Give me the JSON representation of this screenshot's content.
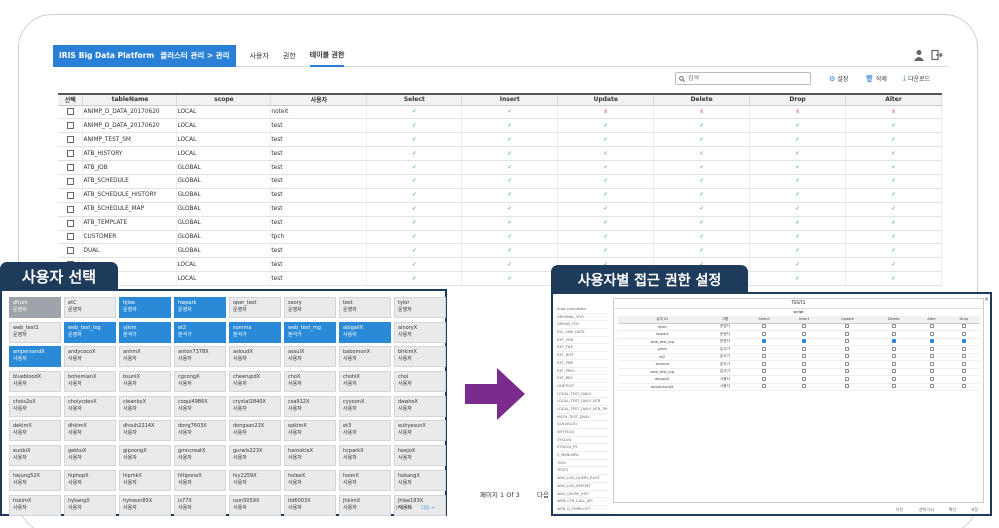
{
  "app": {
    "brand_logo": "IRIS",
    "brand_name": "Big Data Platform",
    "breadcrumb": "클러스터 관리 > 관리",
    "tabs": [
      "사용자",
      "권한",
      "테이블 권한"
    ],
    "active_tab": "테이블 권한",
    "search_placeholder": "검색",
    "btn_settings": "설정",
    "btn_delete": "삭제",
    "btn_download": "다운로드"
  },
  "table": {
    "headers": [
      "선택",
      "tableName",
      "scope",
      "사용자",
      "Select",
      "Insert",
      "Update",
      "Delete",
      "Drop",
      "Alter"
    ],
    "rows": [
      {
        "name": "ANIMP_D_DATA_20170620",
        "scope": "LOCAL",
        "user": "noteit",
        "p": [
          "✓",
          "✓",
          "x",
          "x",
          "x",
          "x"
        ]
      },
      {
        "name": "ANIMP_D_DATA_20170620",
        "scope": "LOCAL",
        "user": "test",
        "p": [
          "✓",
          "✓",
          "✓",
          "✓",
          "✓",
          "✓"
        ]
      },
      {
        "name": "ANIMP_TEST_SM",
        "scope": "LOCAL",
        "user": "test",
        "p": [
          "✓",
          "✓",
          "✓",
          "✓",
          "✓",
          "✓"
        ]
      },
      {
        "name": "ATB_HISTORY",
        "scope": "LOCAL",
        "user": "test",
        "p": [
          "✓",
          "✓",
          "✓",
          "✓",
          "✓",
          "✓"
        ]
      },
      {
        "name": "ATB_JOB",
        "scope": "GLOBAL",
        "user": "test",
        "p": [
          "✓",
          "✓",
          "✓",
          "✓",
          "✓",
          "✓"
        ]
      },
      {
        "name": "ATB_SCHEDULE",
        "scope": "GLOBAL",
        "user": "test",
        "p": [
          "✓",
          "✓",
          "✓",
          "✓",
          "✓",
          "✓"
        ]
      },
      {
        "name": "ATB_SCHEDULE_HISTORY",
        "scope": "GLOBAL",
        "user": "test",
        "p": [
          "✓",
          "✓",
          "✓",
          "✓",
          "✓",
          "✓"
        ]
      },
      {
        "name": "ATB_SCHEDULE_MAP",
        "scope": "GLOBAL",
        "user": "test",
        "p": [
          "✓",
          "✓",
          "✓",
          "✓",
          "✓",
          "✓"
        ]
      },
      {
        "name": "ATB_TEMPLATE",
        "scope": "GLOBAL",
        "user": "test",
        "p": [
          "✓",
          "✓",
          "✓",
          "✓",
          "✓",
          "✓"
        ]
      },
      {
        "name": "CUSTOMER",
        "scope": "GLOBAL",
        "user": "tpch",
        "p": [
          "✓",
          "✓",
          "✓",
          "✓",
          "✓",
          "✓"
        ]
      },
      {
        "name": "DUAL",
        "scope": "GLOBAL",
        "user": "test",
        "p": [
          "✓",
          "✓",
          "✓",
          "✓",
          "✓",
          "✓"
        ]
      },
      {
        "name": "",
        "scope": "LOCAL",
        "user": "test",
        "p": [
          "✓",
          "✓",
          "✓",
          "✓",
          "✓",
          "✓"
        ]
      },
      {
        "name": "",
        "scope": "LOCAL",
        "user": "test",
        "p": [
          "✓",
          "✓",
          "✓",
          "✓",
          "✓",
          "✓"
        ]
      }
    ]
  },
  "pager": {
    "text": "페이지 1 Of 3",
    "next": "다음"
  },
  "left_panel": {
    "title": "사용자 선택",
    "users": [
      {
        "n": "dfruih",
        "r": "운영자",
        "s": "first"
      },
      {
        "n": "etC",
        "r": "운영자",
        "s": ""
      },
      {
        "n": "hjlee",
        "r": "운영자",
        "s": "sel"
      },
      {
        "n": "hwpark",
        "r": "운영자",
        "s": "sel"
      },
      {
        "n": "oper_test",
        "r": "운영자",
        "s": ""
      },
      {
        "n": "seory",
        "r": "운영자",
        "s": ""
      },
      {
        "n": "test",
        "r": "운영자",
        "s": ""
      },
      {
        "n": "tylor",
        "r": "운영자",
        "s": ""
      },
      {
        "n": "web_test1",
        "r": "운영자",
        "s": ""
      },
      {
        "n": "web_test_log",
        "r": "운영자",
        "s": "sel"
      },
      {
        "n": "yjkim",
        "r": "분석가",
        "s": "sel"
      },
      {
        "n": "et2",
        "r": "분석가",
        "s": "sel"
      },
      {
        "n": "somma",
        "r": "분석가",
        "s": "sel"
      },
      {
        "n": "web_test_mg",
        "r": "분석가",
        "s": "sel"
      },
      {
        "n": "abigailX",
        "r": "사용자",
        "s": "sel"
      },
      {
        "n": "ainoryX",
        "r": "사용자",
        "s": ""
      },
      {
        "n": "ampersandX",
        "r": "사용자",
        "s": "sel"
      },
      {
        "n": "andycocoX",
        "r": "사용자",
        "s": ""
      },
      {
        "n": "anhmX",
        "r": "사용자",
        "s": ""
      },
      {
        "n": "anton7378X",
        "r": "사용자",
        "s": ""
      },
      {
        "n": "asloudX",
        "r": "사용자",
        "s": ""
      },
      {
        "n": "assulX",
        "r": "사용자",
        "s": ""
      },
      {
        "n": "babomonX",
        "r": "사용자",
        "s": ""
      },
      {
        "n": "bhkimX",
        "r": "사용자",
        "s": ""
      },
      {
        "n": "bluebloodX",
        "r": "사용자",
        "s": ""
      },
      {
        "n": "bohemianX",
        "r": "사용자",
        "s": ""
      },
      {
        "n": "bsunlX",
        "r": "사용자",
        "s": ""
      },
      {
        "n": "cgcongX",
        "r": "사용자",
        "s": ""
      },
      {
        "n": "cheerupdX",
        "r": "사용자",
        "s": ""
      },
      {
        "n": "choX",
        "r": "사용자",
        "s": ""
      },
      {
        "n": "chohiX",
        "r": "사용자",
        "s": ""
      },
      {
        "n": "choi",
        "r": "사용자",
        "s": ""
      },
      {
        "n": "chois2oX",
        "r": "사용자",
        "s": ""
      },
      {
        "n": "choiycdevX",
        "r": "사용자",
        "s": ""
      },
      {
        "n": "cleanbyX",
        "r": "사용자",
        "s": ""
      },
      {
        "n": "coqui4986X",
        "r": "사용자",
        "s": ""
      },
      {
        "n": "crystal2840X",
        "r": "사용자",
        "s": ""
      },
      {
        "n": "csa912X",
        "r": "사용자",
        "s": ""
      },
      {
        "n": "cyyoonX",
        "r": "사용자",
        "s": ""
      },
      {
        "n": "dawhoX",
        "r": "사용자",
        "s": ""
      },
      {
        "n": "dekimX",
        "r": "사용자",
        "s": ""
      },
      {
        "n": "dhkimX",
        "r": "사용자",
        "s": ""
      },
      {
        "n": "dhsuh2214X",
        "r": "사용자",
        "s": ""
      },
      {
        "n": "dong7603X",
        "r": "사용자",
        "s": ""
      },
      {
        "n": "dongsan23X",
        "r": "사용자",
        "s": ""
      },
      {
        "n": "epkimX",
        "r": "사용자",
        "s": ""
      },
      {
        "n": "et3",
        "r": "사용자",
        "s": ""
      },
      {
        "n": "euhyesunX",
        "r": "사용자",
        "s": ""
      },
      {
        "n": "eunbiX",
        "r": "사용자",
        "s": ""
      },
      {
        "n": "gekkoX",
        "r": "사용자",
        "s": ""
      },
      {
        "n": "gipoongX",
        "r": "사용자",
        "s": ""
      },
      {
        "n": "gmncreatX",
        "r": "사용자",
        "s": ""
      },
      {
        "n": "gurwls223X",
        "r": "사용자",
        "s": ""
      },
      {
        "n": "harookieX",
        "r": "사용자",
        "s": ""
      },
      {
        "n": "hcparkX",
        "r": "사용자",
        "s": ""
      },
      {
        "n": "heejoX",
        "r": "사용자",
        "s": ""
      },
      {
        "n": "hejung52X",
        "r": "사용자",
        "s": ""
      },
      {
        "n": "hiphopX",
        "r": "사용자",
        "s": ""
      },
      {
        "n": "hipmkX",
        "r": "사용자",
        "s": ""
      },
      {
        "n": "hitiponeX",
        "r": "사용자",
        "s": ""
      },
      {
        "n": "hiy2259X",
        "r": "사용자",
        "s": ""
      },
      {
        "n": "holeeX",
        "r": "사용자",
        "s": ""
      },
      {
        "n": "hoonX",
        "r": "사용자",
        "s": ""
      },
      {
        "n": "hokangX",
        "r": "사용자",
        "s": ""
      },
      {
        "n": "hskimX",
        "r": "사용자",
        "s": ""
      },
      {
        "n": "hykangX",
        "r": "사용자",
        "s": ""
      },
      {
        "n": "hykwon83X",
        "r": "사용자",
        "s": ""
      },
      {
        "n": "iz77X",
        "r": "사용자",
        "s": ""
      },
      {
        "n": "ison5059X",
        "r": "사용자",
        "s": ""
      },
      {
        "n": "itd6003X",
        "r": "사용자",
        "s": ""
      },
      {
        "n": "jhkimX",
        "r": "사용자",
        "s": ""
      },
      {
        "n": "jhlee193X",
        "r": "사용자",
        "s": ""
      }
    ],
    "footer_left": "선택 취소",
    "footer_right": "다음 →"
  },
  "right_panel": {
    "title": "사용자별 접근 권한 설정",
    "table_list": [
      "Auto-completed",
      "ORIGINAL_YOO",
      "ORIGIN_YOO",
      "ESL_LINE_DATA",
      "EXT_YOB",
      "EXT_FILE",
      "EXT_HIST",
      "EXT_PMP",
      "EXT_PREC",
      "EXT_RES",
      "LINE7EXT",
      "LOCAL_TEST_DAILY",
      "LOCAL_TEST_DAILY_NTB",
      "LOCAL_TEST_DAILY_NTB_TM",
      "MATH_TEST_DAILY",
      "QUEUELOG",
      "SMTPLOG",
      "SYSLOG",
      "SYSLOG_P5",
      "S_MANUSRC",
      "T001",
      "TEST1",
      "WAS_LOG_QUERY_RUST",
      "WAS_LOG_REPORT",
      "WAS_QUERY_HIST",
      "WEB_CTR_CALL_API",
      "WEB_D_TEMPLOPT"
    ],
    "table_title": "TEST1",
    "script_label": "script",
    "headers": [
      "유저 ID",
      "그룹",
      "Select",
      "Insert",
      "Update",
      "Delete",
      "Alter",
      "Drop"
    ],
    "rows": [
      {
        "id": "hjlee",
        "g": "운영자",
        "p": [
          0,
          0,
          0,
          0,
          0,
          0
        ]
      },
      {
        "id": "hwpark",
        "g": "운영자",
        "p": [
          0,
          0,
          0,
          0,
          0,
          0
        ]
      },
      {
        "id": "web_test_log",
        "g": "운영자",
        "p": [
          1,
          1,
          0,
          1,
          1,
          1
        ]
      },
      {
        "id": "yjkim",
        "g": "분석가",
        "p": [
          0,
          0,
          0,
          0,
          0,
          0
        ]
      },
      {
        "id": "et2",
        "g": "분석가",
        "p": [
          0,
          0,
          0,
          0,
          0,
          0
        ]
      },
      {
        "id": "somma",
        "g": "분석가",
        "p": [
          0,
          0,
          0,
          0,
          0,
          0
        ]
      },
      {
        "id": "web_test_mg",
        "g": "분석가",
        "p": [
          0,
          0,
          0,
          0,
          0,
          0
        ]
      },
      {
        "id": "abigailX",
        "g": "사용자",
        "p": [
          0,
          0,
          0,
          0,
          0,
          0
        ]
      },
      {
        "id": "ampersandX",
        "g": "사용자",
        "p": [
          0,
          0,
          0,
          0,
          0,
          0
        ]
      }
    ],
    "footer": [
      "이전",
      "선택 다시",
      "확인",
      "저장"
    ]
  }
}
